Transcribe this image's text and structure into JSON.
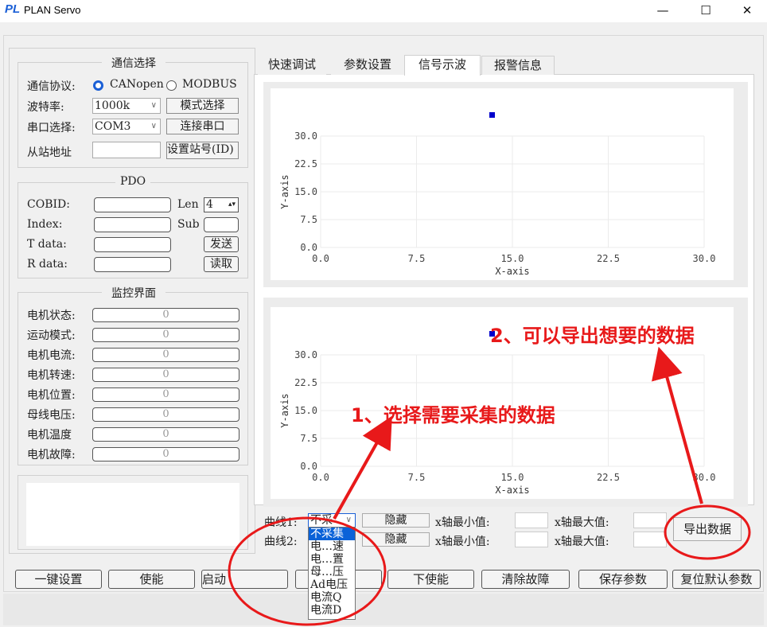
{
  "window": {
    "title": "PLAN Servo",
    "logo": "PL",
    "minimize": "—",
    "maximize": "☐",
    "close": "✕"
  },
  "comm": {
    "title": "通信选择",
    "protocol_label": "通信协议:",
    "protocol_options": [
      "CANopen",
      "MODBUS"
    ],
    "baud_label": "波特率:",
    "baud_value": "1000k",
    "mode_button": "模式选择",
    "port_label": "串口选择:",
    "port_value": "COM3",
    "connect_button": "连接串口",
    "slave_label": "从站地址",
    "slave_value": "",
    "set_id_button": "设置站号(ID)"
  },
  "pdo": {
    "title": "PDO",
    "cobid_label": "COBID:",
    "len_label": "Len",
    "len_value": "4",
    "index_label": "Index:",
    "sub_label": "Sub",
    "tdata_label": "T data:",
    "send_button": "发送",
    "rdata_label": "R data:",
    "read_button": "读取"
  },
  "monitor": {
    "title": "监控界面",
    "rows": [
      {
        "label": "电机状态:",
        "value": "0"
      },
      {
        "label": "运动模式:",
        "value": "0"
      },
      {
        "label": "电机电流:",
        "value": "0"
      },
      {
        "label": "电机转速:",
        "value": "0"
      },
      {
        "label": "电机位置:",
        "value": "0"
      },
      {
        "label": "母线电压:",
        "value": "0"
      },
      {
        "label": "电机温度",
        "value": "0"
      },
      {
        "label": "电机故障:",
        "value": "0"
      }
    ]
  },
  "tabs": [
    "快速调试",
    "参数设置",
    "信号示波",
    "报警信息"
  ],
  "active_tab": "信号示波",
  "chart_data": [
    {
      "type": "scatter",
      "title": "",
      "xlabel": "X-axis",
      "ylabel": "Y-axis",
      "xlim": [
        0,
        30
      ],
      "ylim": [
        0,
        30
      ],
      "xticks": [
        "0.0",
        "7.5",
        "15.0",
        "22.5",
        "30.0"
      ],
      "yticks": [
        "0.0",
        "7.5",
        "15.0",
        "22.5",
        "30.0"
      ],
      "grid": true,
      "series": [
        {
          "values": []
        }
      ],
      "legend_marker_color": "#0000cc"
    },
    {
      "type": "scatter",
      "title": "",
      "xlabel": "X-axis",
      "ylabel": "Y-axis",
      "xlim": [
        0,
        30
      ],
      "ylim": [
        0,
        30
      ],
      "xticks": [
        "0.0",
        "7.5",
        "15.0",
        "22.5",
        "30.0"
      ],
      "yticks": [
        "0.0",
        "7.5",
        "15.0",
        "22.5",
        "30.0"
      ],
      "grid": true,
      "series": [
        {
          "values": []
        }
      ],
      "legend_marker_color": "#0000cc"
    }
  ],
  "curves": {
    "curve1_label": "曲线1:",
    "curve1_value": "不采",
    "curve2_label": "曲线2:",
    "hide_button": "隐藏",
    "xmin_label": "x轴最小值:",
    "xmax_label": "x轴最大值:",
    "export_button": "导出数据",
    "dropdown_options": [
      "不采集",
      "电…速",
      "电…置",
      "母…压",
      "Ad电压",
      "电流Q",
      "电流D"
    ]
  },
  "bottom_buttons": [
    "一键设置",
    "使能",
    "启动",
    "",
    "下使能",
    "清除故障",
    "保存参数",
    "复位默认参数"
  ],
  "annotations": {
    "step1": "1、选择需要采集的数据",
    "step2": "2、可以导出想要的数据",
    "color": "#e8191a"
  }
}
